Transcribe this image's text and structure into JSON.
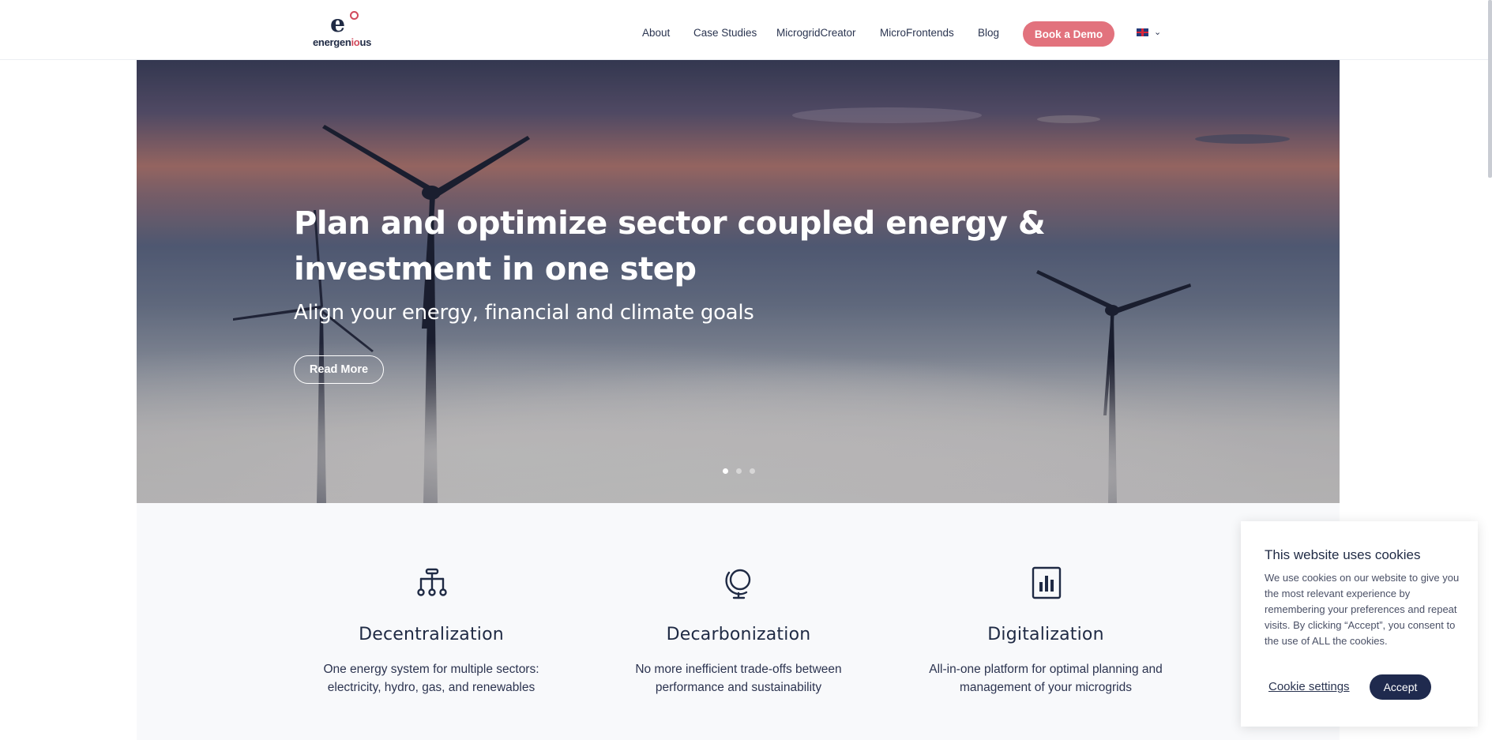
{
  "header": {
    "logo_text_a": "energen",
    "logo_text_b": "io",
    "logo_text_c": "us",
    "nav": [
      "About",
      "Case Studies",
      "MicrogridCreator",
      "MicroFrontends",
      "Blog"
    ],
    "cta_label": "Book a Demo",
    "language_icon": "uk-flag-icon"
  },
  "hero": {
    "title": "Plan and optimize sector coupled energy & investment in one step",
    "subtitle": "Align your energy, financial and climate goals",
    "button_label": "Read More",
    "slides_count": 3,
    "active_slide": 1
  },
  "features": [
    {
      "icon": "sitemap-icon",
      "title": "Decentralization",
      "text": "One energy system for multiple sectors: electricity, hydro, gas, and renewables"
    },
    {
      "icon": "globe-icon",
      "title": "Decarbonization",
      "text": "No more inefficient trade-offs between performance and sustainability"
    },
    {
      "icon": "bar-chart-icon",
      "title": "Digitalization",
      "text": "All-in-one platform for optimal planning and management of your microgrids"
    }
  ],
  "cookie": {
    "title": "This website uses cookies",
    "text": "We use cookies on our website to give you the most relevant experience by remembering your preferences and repeat visits. By clicking “Accept”, you consent to the use of ALL the cookies.",
    "settings_label": "Cookie settings",
    "accept_label": "Accept"
  },
  "colors": {
    "brand_navy": "#1f2a44",
    "brand_red": "#d14a5c",
    "cta": "#e2727d",
    "accept": "#1f2a4e"
  }
}
